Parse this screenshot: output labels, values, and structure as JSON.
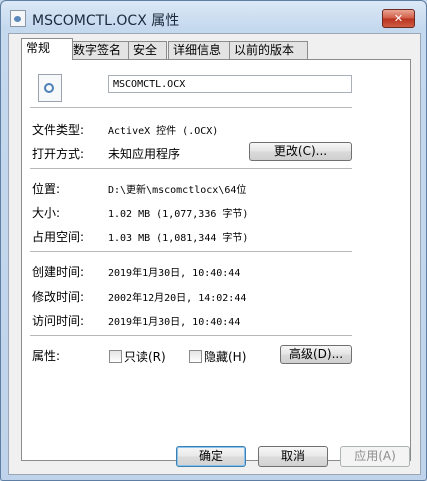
{
  "window": {
    "title": "MSCOMCTL.OCX 属性",
    "close_label": "✕"
  },
  "tabs": [
    {
      "label": "常规",
      "active": true
    },
    {
      "label": "数字签名",
      "active": false
    },
    {
      "label": "安全",
      "active": false
    },
    {
      "label": "详细信息",
      "active": false
    },
    {
      "label": "以前的版本",
      "active": false
    }
  ],
  "general": {
    "file_name": "MSCOMCTL.OCX",
    "file_type_label": "文件类型:",
    "file_type_value": "ActiveX 控件 (.OCX)",
    "open_with_label": "打开方式:",
    "open_with_value": "未知应用程序",
    "change_button": "更改(C)...",
    "location_label": "位置:",
    "location_value": "D:\\更新\\mscomctlocx\\64位",
    "size_label": "大小:",
    "size_value": "1.02 MB (1,077,336 字节)",
    "size_on_disk_label": "占用空间:",
    "size_on_disk_value": "1.03 MB (1,081,344 字节)",
    "created_label": "创建时间:",
    "created_value": "2019年1月30日, 10:40:44",
    "modified_label": "修改时间:",
    "modified_value": "2002年12月20日, 14:02:44",
    "accessed_label": "访问时间:",
    "accessed_value": "2019年1月30日, 10:40:44",
    "attributes_label": "属性:",
    "readonly_label": "只读(R)",
    "readonly_checked": false,
    "hidden_label": "隐藏(H)",
    "hidden_checked": false,
    "advanced_button": "高级(D)..."
  },
  "footer": {
    "ok": "确定",
    "cancel": "取消",
    "apply": "应用(A)"
  }
}
